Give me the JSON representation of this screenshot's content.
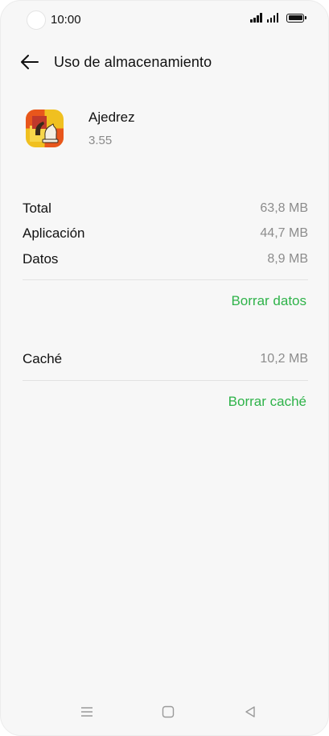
{
  "status_bar": {
    "time": "10:00"
  },
  "header": {
    "title": "Uso de almacenamiento",
    "back_icon": "arrow-left-icon"
  },
  "app": {
    "name": "Ajedrez",
    "version": "3.55",
    "icon": "chess-app-icon"
  },
  "storage": {
    "rows": [
      {
        "label": "Total",
        "value": "63,8 MB"
      },
      {
        "label": "Aplicación",
        "value": "44,7 MB"
      },
      {
        "label": "Datos",
        "value": "8,9 MB"
      }
    ],
    "clear_data_label": "Borrar datos"
  },
  "cache": {
    "label": "Caché",
    "value": "10,2 MB",
    "clear_cache_label": "Borrar caché"
  },
  "nav": {
    "menu_icon": "menu-icon",
    "home_icon": "home-icon",
    "back_icon": "back-triangle-icon"
  },
  "colors": {
    "accent": "#2fb34a",
    "background": "#f7f7f7",
    "secondary_text": "#8c8c8c"
  }
}
